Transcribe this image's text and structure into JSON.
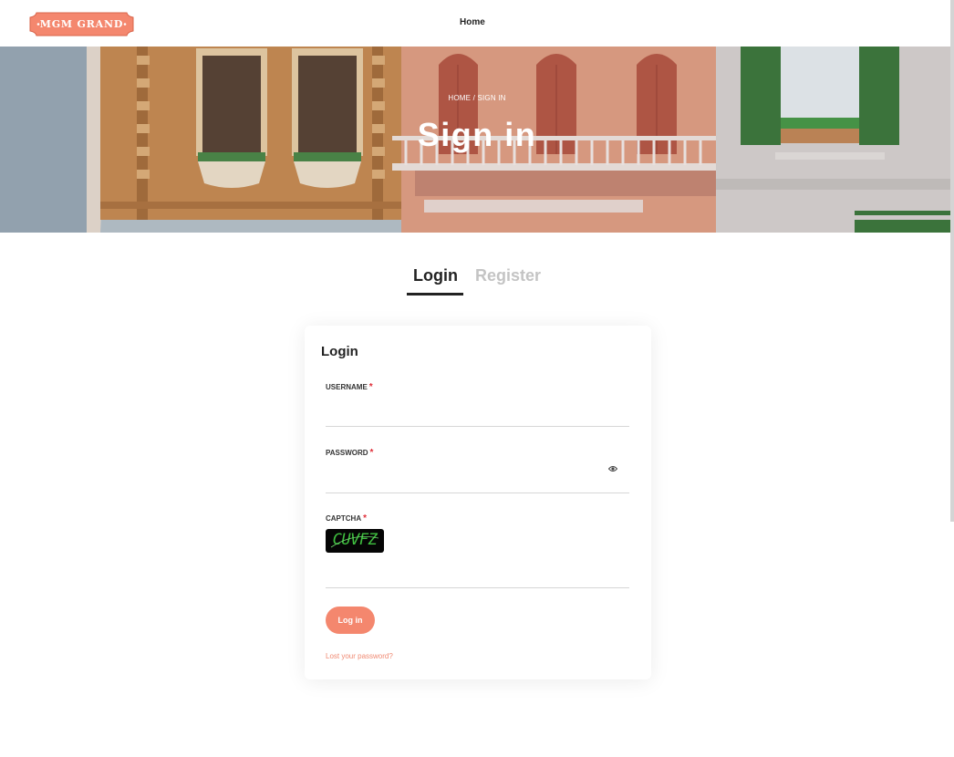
{
  "brand": {
    "logo_text": "MGM GRAND",
    "color": "#f4876e"
  },
  "nav": {
    "home": "Home"
  },
  "hero": {
    "breadcrumb": "HOME / SIGN IN",
    "title": "Sign in"
  },
  "tabs": {
    "login": "Login",
    "register": "Register"
  },
  "login_form": {
    "title": "Login",
    "username_label": "USERNAME",
    "password_label": "PASSWORD",
    "captcha_label": "CAPTCHA",
    "required_mark": "*",
    "captcha_text": "CUVFZ",
    "password_toggle_icon": "eye-icon",
    "submit_label": "Log in",
    "lost_password": "Lost your password?"
  },
  "colors": {
    "accent": "#f4876e",
    "required": "#e0303a",
    "tab_inactive": "#c4c4c4"
  }
}
